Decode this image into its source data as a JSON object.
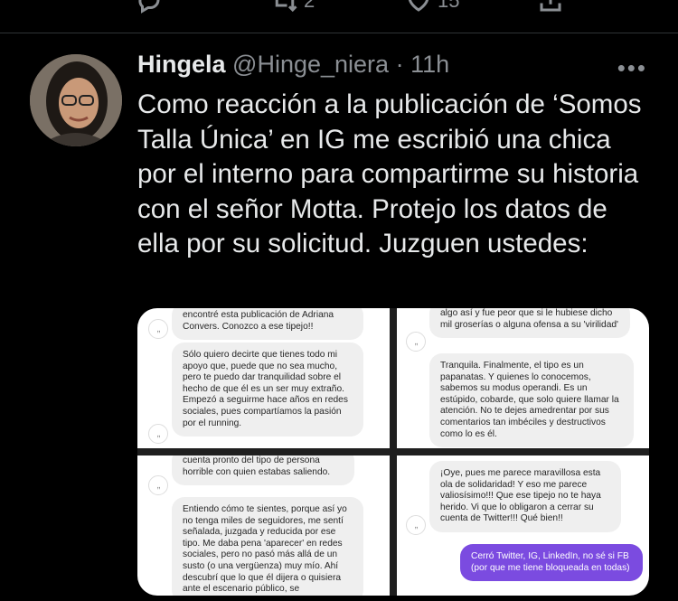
{
  "actions": {
    "retweets": "2",
    "likes": "15"
  },
  "tweet": {
    "display_name": "Hingela",
    "handle": "@Hinge_niera",
    "separator": "·",
    "time": "11h",
    "text": "Como reacción a la publicación de ‘Somos Talla Única’ en IG me escribió una chica por el interno para compartirme su historia con el señor Motta. Protejo los datos de ella por su solicitud. Juzguen ustedes:"
  },
  "screenshots": {
    "panel1": {
      "b1": "encontré esta publicación de Adriana Convers. Conozco a ese tipejo!!",
      "b2": "Sólo quiero decirte que tienes todo mi apoyo que, puede que no sea mucho, pero te puedo dar tranquilidad sobre el hecho de que él es un ser muy extraño. Empezó a seguirme hace años en redes sociales, pues compartíamos la pasión por el running."
    },
    "panel2": {
      "b1": "algo así y fue peor que si le hubiese dicho mil groserías o alguna ofensa a su 'virilidad'",
      "b2": "Tranquila. Finalmente, el tipo es un papanatas. Y quienes lo conocemos, sabemos su modus operandi. Es un estúpido, cobarde, que solo quiere llamar la atención. No te dejes amedrentar por sus comentarios tan imbéciles y destructivos como lo es él."
    },
    "panel3": {
      "b1": "cuenta pronto del tipo de persona horrible con quien estabas saliendo.",
      "b2": "Entiendo cómo te sientes, porque así yo no tenga miles de seguidores, me sentí señalada, juzgada y reducida por ese tipo. Me daba pena 'aparecer' en redes sociales, pero no pasó más allá de un susto (o una vergüenza) muy mío. Ahí descubrí que lo que él dijera o quisiera ante el escenario público, se"
    },
    "panel4": {
      "b1": "¡Oye, pues me parece maravillosa esta ola de solidaridad! Y eso me parece valiosísimo!!! Que ese tipejo no te haya herido. Vi que lo obligaron a cerrar su cuenta de Twitter!!! Qué bien!!",
      "b2": "Cerró Twitter, IG, LinkedIn, no sé si FB (por que me tiene bloqueada en todas)"
    }
  }
}
